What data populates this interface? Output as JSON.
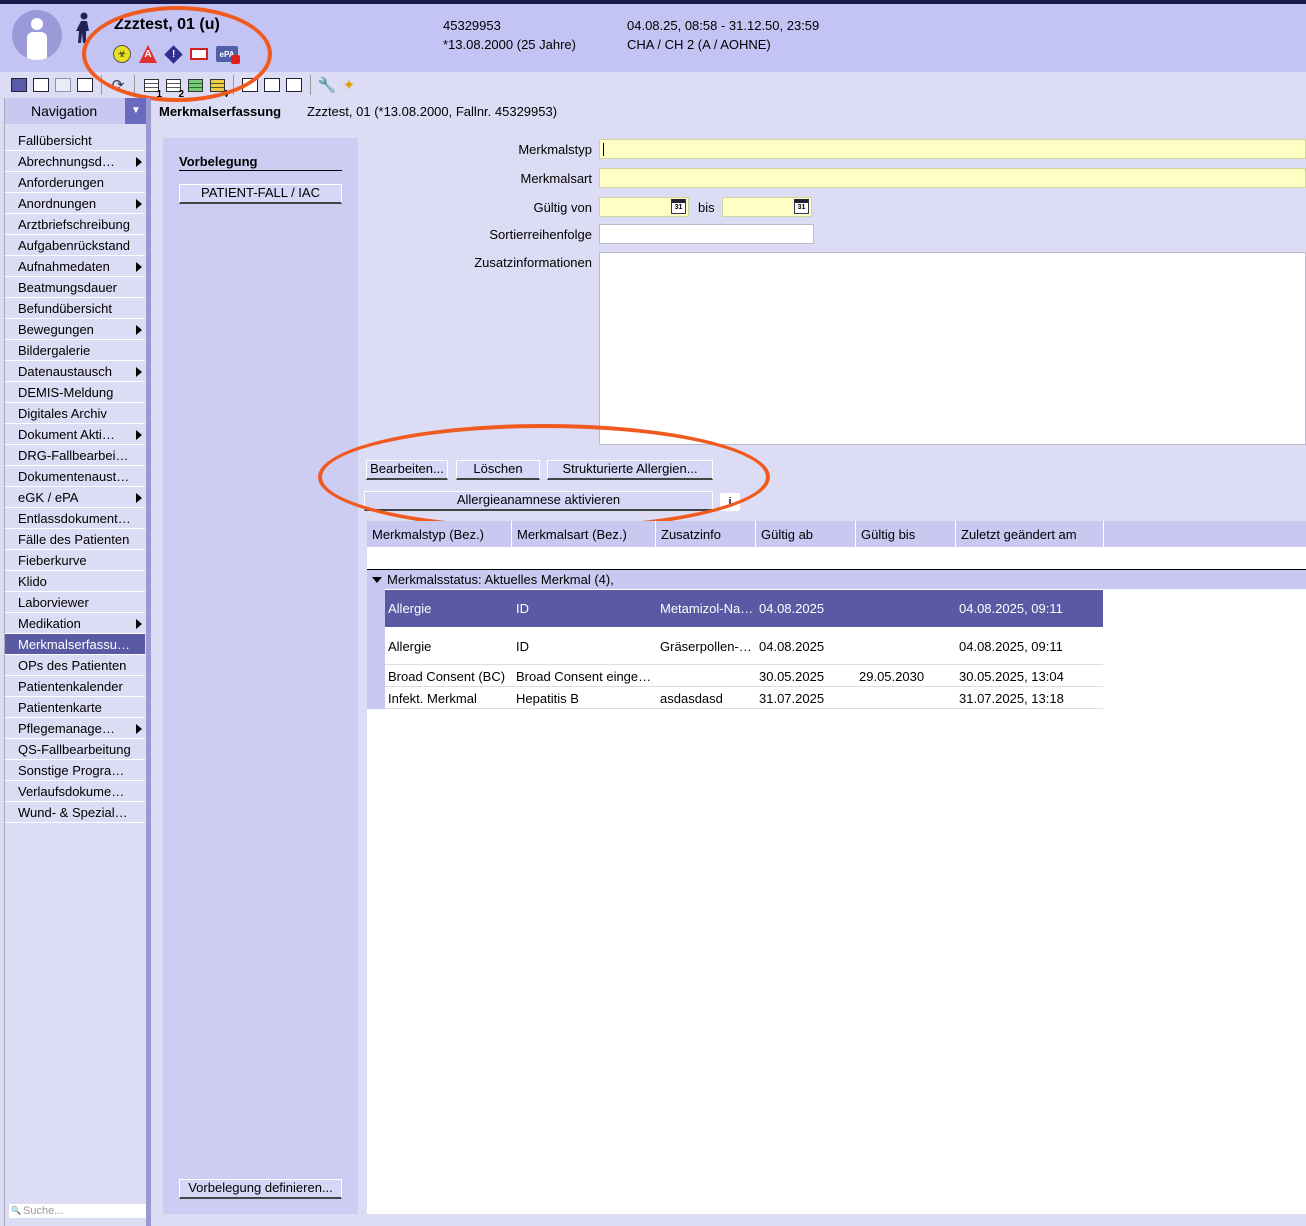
{
  "header": {
    "patient_name": "Zzztest, 01 (u)",
    "case_number": "45329953",
    "birthdate": "*13.08.2000 (25 Jahre)",
    "stay_period": "04.08.25, 08:58 - 31.12.50, 23:59",
    "ward": "CHA / CH 2  (A / AOHNE)",
    "icons": [
      "biohazard-icon",
      "allergy-alert-icon",
      "warning-icon",
      "card-icon",
      "epa-locked-icon"
    ]
  },
  "toolbar": {
    "badges": [
      "1",
      "2",
      "4"
    ]
  },
  "navigation": {
    "title": "Navigation",
    "search_placeholder": "Suche...",
    "items": [
      {
        "label": "Fallübersicht",
        "submenu": false
      },
      {
        "label": "Abrechnungsd…",
        "submenu": true
      },
      {
        "label": "Anforderungen",
        "submenu": false
      },
      {
        "label": "Anordnungen",
        "submenu": true
      },
      {
        "label": "Arztbriefschreibung",
        "submenu": false
      },
      {
        "label": "Aufgabenrückstand",
        "submenu": false
      },
      {
        "label": "Aufnahmedaten",
        "submenu": true
      },
      {
        "label": "Beatmungsdauer",
        "submenu": false
      },
      {
        "label": "Befundübersicht",
        "submenu": false
      },
      {
        "label": "Bewegungen",
        "submenu": true
      },
      {
        "label": "Bildergalerie",
        "submenu": false
      },
      {
        "label": "Datenaustausch",
        "submenu": true
      },
      {
        "label": "DEMIS-Meldung",
        "submenu": false
      },
      {
        "label": "Digitales Archiv",
        "submenu": false
      },
      {
        "label": "Dokument Akti…",
        "submenu": true
      },
      {
        "label": "DRG-Fallbearbeit…",
        "submenu": false
      },
      {
        "label": "Dokumentenaust…",
        "submenu": false
      },
      {
        "label": "eGK / ePA",
        "submenu": true
      },
      {
        "label": "Entlassdokument…",
        "submenu": false
      },
      {
        "label": "Fälle des Patienten",
        "submenu": false
      },
      {
        "label": "Fieberkurve",
        "submenu": false
      },
      {
        "label": "Klido",
        "submenu": false
      },
      {
        "label": "Laborviewer",
        "submenu": false
      },
      {
        "label": "Medikation",
        "submenu": true
      },
      {
        "label": "Merkmalserfassung",
        "submenu": false,
        "active": true
      },
      {
        "label": "OPs des Patienten",
        "submenu": false
      },
      {
        "label": "Patientenkalender",
        "submenu": false
      },
      {
        "label": "Patientenkarte",
        "submenu": false
      },
      {
        "label": "Pflegemanage…",
        "submenu": true
      },
      {
        "label": "QS-Fallbearbeitung",
        "submenu": false
      },
      {
        "label": "Sonstige Program…",
        "submenu": false
      },
      {
        "label": "Verlaufsdokument…",
        "submenu": false
      },
      {
        "label": "Wund- & Speziald…",
        "submenu": false
      }
    ]
  },
  "content": {
    "title": "Merkmalserfassung",
    "subtitle": "Zzztest, 01 (*13.08.2000, Fallnr. 45329953)"
  },
  "preset": {
    "title": "Vorbelegung",
    "button": "PATIENT-FALL / IAC",
    "define_button": "Vorbelegung definieren..."
  },
  "form": {
    "type_label": "Merkmalstyp",
    "type_value": "",
    "kind_label": "Merkmalsart",
    "kind_value": "",
    "valid_from_label": "Gültig von",
    "valid_to_label": "bis",
    "calendar_text": "31",
    "sort_label": "Sortierreihenfolge",
    "info_label": "Zusatzinformationen"
  },
  "actions": {
    "edit": "Bearbeiten...",
    "delete": "Löschen",
    "structured": "Strukturierte Allergien...",
    "activate_allergy": "Allergieanamnese aktivieren",
    "info": "i"
  },
  "table": {
    "columns": [
      "Merkmalstyp (Bez.)",
      "Merkmalsart (Bez.)",
      "Zusatzinfo",
      "Gültig ab",
      "Gültig bis",
      "Zuletzt geändert am"
    ],
    "group_label": "Merkmalsstatus: Aktuelles Merkmal (4),",
    "rows": [
      {
        "type": "Allergie",
        "kind": "ID",
        "info": "Metamizol-Na…",
        "from": "04.08.2025",
        "to": "",
        "changed": "04.08.2025, 09:11",
        "selected": true
      },
      {
        "type": "Allergie",
        "kind": "ID",
        "info": "Gräserpollen-…",
        "from": "04.08.2025",
        "to": "",
        "changed": "04.08.2025, 09:11"
      },
      {
        "type": "Broad Consent (BC)",
        "kind": "Broad Consent einge…",
        "info": "",
        "from": "30.05.2025",
        "to": "29.05.2030",
        "changed": "30.05.2025, 13:04"
      },
      {
        "type": "Infekt. Merkmal",
        "kind": "Hepatitis B",
        "info": "asdasdasd",
        "from": "31.07.2025",
        "to": "",
        "changed": "31.07.2025, 13:18"
      }
    ]
  },
  "colors": {
    "header_bg": "#c4c4f4",
    "selection": "#5a5aa4",
    "required_field": "#ffffc4",
    "annotation": "#f05a1e"
  }
}
